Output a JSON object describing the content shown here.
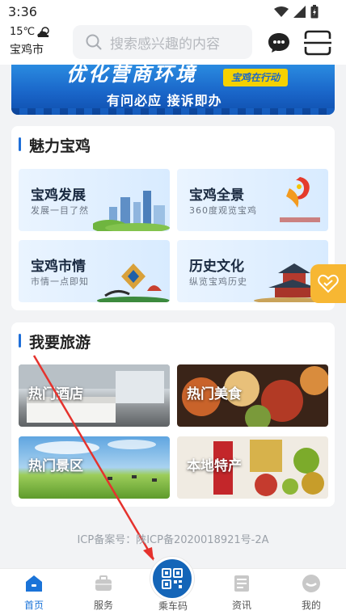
{
  "status": {
    "time": "3:36"
  },
  "header": {
    "weather_temp": "15℃",
    "city": "宝鸡市",
    "search_placeholder": "搜索感兴趣的内容"
  },
  "banner": {
    "title": "优化营商环境",
    "tag": "宝鸡在行动",
    "subtitle": "有问必应  接诉即办"
  },
  "charm": {
    "title": "魅力宝鸡",
    "tiles": [
      {
        "title": "宝鸡发展",
        "sub": "发展一目了然"
      },
      {
        "title": "宝鸡全景",
        "sub": "360度观览宝鸡"
      },
      {
        "title": "宝鸡市情",
        "sub": "市情一点即知"
      },
      {
        "title": "历史文化",
        "sub": "纵览宝鸡历史"
      }
    ]
  },
  "travel": {
    "title": "我要旅游",
    "tiles": [
      {
        "title": "热门酒店"
      },
      {
        "title": "热门美食"
      },
      {
        "title": "热门景区"
      },
      {
        "title": "本地特产"
      }
    ]
  },
  "icp": "ICP备案号：陕ICP备2020018921号-2A",
  "tabbar": {
    "items": [
      {
        "label": "首页"
      },
      {
        "label": "服务"
      },
      {
        "label": "乘车码"
      },
      {
        "label": "资讯"
      },
      {
        "label": "我的"
      }
    ]
  },
  "colors": {
    "accent": "#1a73d8",
    "banner": "#1a66c9",
    "fav": "#f7b733"
  }
}
